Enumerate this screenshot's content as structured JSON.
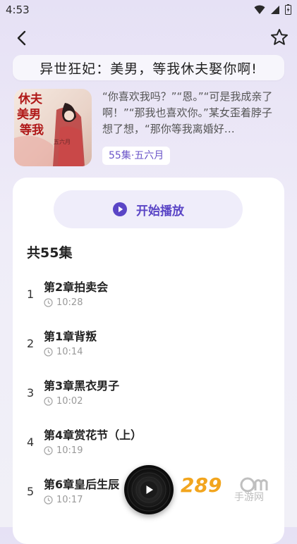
{
  "status": {
    "time": "4:53"
  },
  "book": {
    "title": "异世狂妃：美男，等我休夫娶你啊!",
    "description": "“你喜欢我吗？”“恩。”“可是我成亲了啊！”“那我也喜欢你。”某女歪着脖子想了想，“那你等我离婚好…",
    "meta": "55集·五六月",
    "cover_text": [
      "休夫",
      "美男",
      "等我",
      "五六月"
    ]
  },
  "player": {
    "play_label": "开始播放"
  },
  "episodes_count": "共55集",
  "episodes": [
    {
      "num": "1",
      "title": "第2章拍卖会",
      "duration": "10:28"
    },
    {
      "num": "2",
      "title": "第1章背叛",
      "duration": "10:14"
    },
    {
      "num": "3",
      "title": "第3章黑衣男子",
      "duration": "10:02"
    },
    {
      "num": "4",
      "title": "第4章赏花节（上）",
      "duration": "10:19"
    },
    {
      "num": "5",
      "title": "第6章皇后生辰",
      "duration": "10:17"
    }
  ],
  "watermark": {
    "main": "289",
    "sub": "手游网"
  },
  "colors": {
    "accent": "#5a45c6",
    "background": "#ece8f7"
  },
  "icons": [
    "back-arrow-icon",
    "star-icon",
    "play-circle-icon",
    "clock-icon",
    "vinyl-disc-icon"
  ]
}
